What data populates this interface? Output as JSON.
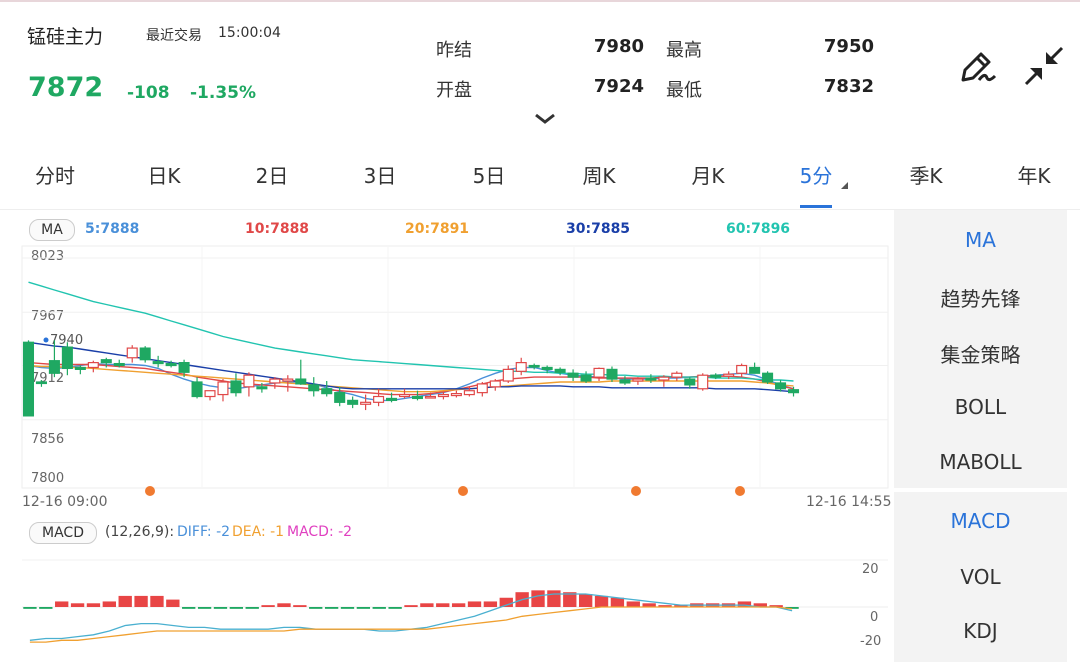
{
  "header": {
    "title": "锰硅主力",
    "last_trade_label": "最近交易",
    "last_trade_time": "15:00:04",
    "price": "7872",
    "change": "-108",
    "change_pct": "-1.35%",
    "price_color": "#1fa862",
    "stats": {
      "prev_settle_label": "昨结",
      "prev_settle": "7980",
      "high_label": "最高",
      "high": "7950",
      "open_label": "开盘",
      "open": "7924",
      "low_label": "最低",
      "low": "7832"
    },
    "icons": [
      "pen-icon",
      "collapse-icon",
      "chevron-down-icon"
    ]
  },
  "tabs": [
    {
      "label": "分时"
    },
    {
      "label": "日K"
    },
    {
      "label": "2日"
    },
    {
      "label": "3日"
    },
    {
      "label": "5日"
    },
    {
      "label": "周K"
    },
    {
      "label": "月K"
    },
    {
      "label": "5分",
      "active": true
    },
    {
      "label": "季K"
    },
    {
      "label": "年K"
    }
  ],
  "accent_color": "#2a73d9",
  "ma_indicator": {
    "badge": "MA",
    "values": [
      {
        "text": "5:7888",
        "color": "#4a90d9"
      },
      {
        "text": "10:7888",
        "color": "#e04848"
      },
      {
        "text": "20:7891",
        "color": "#f0a030"
      },
      {
        "text": "30:7885",
        "color": "#1a3fa8"
      },
      {
        "text": "60:7896",
        "color": "#22c4b0"
      }
    ]
  },
  "price_axis": {
    "labels": [
      "8023",
      "7967",
      "7912",
      "7856",
      "7800"
    ],
    "max_marker": "7940"
  },
  "time_axis": {
    "start": "12-16 09:00",
    "end": "12-16 14:55"
  },
  "macd_indicator": {
    "badge": "MACD",
    "params": "(12,26,9):",
    "diff": "DIFF: -2",
    "dea": "DEA: -1",
    "macd": "MACD: -2",
    "axis_labels": [
      "20",
      "0",
      "-20"
    ]
  },
  "sidebar": {
    "main_items": [
      "MA",
      "趋势先锋",
      "集金策略",
      "BOLL",
      "MABOLL"
    ],
    "sub_items": [
      "MACD",
      "VOL",
      "KDJ"
    ]
  },
  "chart_data": [
    {
      "type": "candlestick",
      "title": "",
      "ylim": [
        7800,
        8023
      ],
      "y_ticks": [
        8023,
        7967,
        7912,
        7856,
        7800
      ],
      "x_range": [
        "12-16 09:00",
        "12-16 14:55"
      ],
      "up_color": "#e04848",
      "down_color": "#1fa862",
      "candles": [
        [
          7936,
          7938,
          7894,
          7860
        ],
        [
          7895,
          7897,
          7890,
          7894
        ],
        [
          7917,
          7938,
          7900,
          7904
        ],
        [
          7931,
          7936,
          7902,
          7909
        ],
        [
          7910,
          7912,
          7903,
          7908
        ],
        [
          7910,
          7917,
          7905,
          7915
        ],
        [
          7918,
          7920,
          7910,
          7915
        ],
        [
          7914,
          7918,
          7910,
          7912
        ],
        [
          7920,
          7933,
          7915,
          7930
        ],
        [
          7930,
          7932,
          7915,
          7918
        ],
        [
          7916,
          7922,
          7910,
          7914
        ],
        [
          7914,
          7917,
          7910,
          7912
        ],
        [
          7915,
          7918,
          7900,
          7905
        ],
        [
          7895,
          7900,
          7878,
          7880
        ],
        [
          7880,
          7885,
          7876,
          7886
        ],
        [
          7882,
          7898,
          7875,
          7895
        ],
        [
          7896,
          7904,
          7880,
          7884
        ],
        [
          7890,
          7905,
          7880,
          7902
        ],
        [
          7890,
          7894,
          7884,
          7888
        ],
        [
          7894,
          7900,
          7888,
          7898
        ],
        [
          7896,
          7902,
          7885,
          7898
        ],
        [
          7898,
          7918,
          7892,
          7893
        ],
        [
          7892,
          7900,
          7880,
          7886
        ],
        [
          7888,
          7896,
          7880,
          7883
        ],
        [
          7884,
          7890,
          7870,
          7874
        ],
        [
          7876,
          7880,
          7868,
          7872
        ],
        [
          7872,
          7882,
          7866,
          7874
        ],
        [
          7874,
          7888,
          7870,
          7880
        ],
        [
          7878,
          7884,
          7874,
          7876
        ],
        [
          7880,
          7888,
          7878,
          7882
        ],
        [
          7880,
          7886,
          7876,
          7878
        ],
        [
          7879,
          7884,
          7878,
          7880
        ],
        [
          7880,
          7885,
          7877,
          7882
        ],
        [
          7881,
          7886,
          7879,
          7883
        ],
        [
          7882,
          7890,
          7880,
          7886
        ],
        [
          7884,
          7895,
          7880,
          7893
        ],
        [
          7890,
          7898,
          7886,
          7896
        ],
        [
          7896,
          7912,
          7894,
          7908
        ],
        [
          7906,
          7920,
          7902,
          7915
        ],
        [
          7912,
          7914,
          7908,
          7911
        ],
        [
          7910,
          7912,
          7904,
          7908
        ],
        [
          7908,
          7910,
          7902,
          7905
        ],
        [
          7904,
          7908,
          7896,
          7900
        ],
        [
          7902,
          7906,
          7894,
          7896
        ],
        [
          7900,
          7910,
          7896,
          7909
        ],
        [
          7908,
          7911,
          7895,
          7898
        ],
        [
          7897,
          7901,
          7892,
          7894
        ],
        [
          7896,
          7900,
          7892,
          7898
        ],
        [
          7899,
          7903,
          7894,
          7897
        ],
        [
          7897,
          7902,
          7890,
          7900
        ],
        [
          7900,
          7906,
          7896,
          7904
        ],
        [
          7898,
          7900,
          7888,
          7892
        ],
        [
          7888,
          7904,
          7886,
          7902
        ],
        [
          7902,
          7904,
          7898,
          7900
        ],
        [
          7901,
          7906,
          7898,
          7903
        ],
        [
          7904,
          7914,
          7900,
          7912
        ],
        [
          7910,
          7915,
          7904,
          7904
        ],
        [
          7904,
          7906,
          7893,
          7895
        ],
        [
          7894,
          7897,
          7885,
          7888
        ],
        [
          7887,
          7890,
          7880,
          7884
        ]
      ],
      "ma": {
        "MA5": {
          "color": "#4a90d9",
          "values": [
            7912,
            7910,
            7909,
            7910,
            7912,
            7914,
            7913,
            7913,
            7913,
            7912,
            7909,
            7903,
            7898,
            7894,
            7891,
            7889,
            7888,
            7890,
            7892,
            7894,
            7895,
            7895,
            7893,
            7889,
            7885,
            7882,
            7878,
            7876,
            7876,
            7878,
            7880,
            7882,
            7884,
            7888,
            7893,
            7899,
            7904,
            7908,
            7910,
            7910,
            7907,
            7904,
            7902,
            7901,
            7900,
            7899,
            7898,
            7898,
            7898,
            7899,
            7899,
            7900,
            7901,
            7902,
            7903,
            7904,
            7902,
            7897,
            7892,
            7888
          ]
        },
        "MA10": {
          "color": "#e04848",
          "values": [
            7915,
            7914,
            7913,
            7913,
            7913,
            7913,
            7912,
            7911,
            7910,
            7909,
            7907,
            7905,
            7903,
            7900,
            7898,
            7896,
            7894,
            7893,
            7892,
            7891,
            7890,
            7889,
            7888,
            7887,
            7886,
            7885,
            7884,
            7883,
            7882,
            7882,
            7882,
            7883,
            7885,
            7887,
            7890,
            7893,
            7896,
            7898,
            7899,
            7900,
            7900,
            7900,
            7900,
            7900,
            7899,
            7899,
            7899,
            7899,
            7899,
            7900,
            7900,
            7900,
            7901,
            7901,
            7901,
            7900,
            7898,
            7895,
            7891,
            7888
          ]
        },
        "MA20": {
          "color": "#f0a030",
          "values": [
            7912,
            7911,
            7911,
            7910,
            7910,
            7909,
            7908,
            7907,
            7906,
            7905,
            7904,
            7903,
            7902,
            7901,
            7900,
            7899,
            7898,
            7897,
            7896,
            7895,
            7894,
            7893,
            7892,
            7891,
            7890,
            7889,
            7888,
            7887,
            7886,
            7885,
            7885,
            7885,
            7886,
            7887,
            7888,
            7889,
            7890,
            7891,
            7892,
            7893,
            7894,
            7895,
            7895,
            7895,
            7895,
            7896,
            7896,
            7896,
            7896,
            7896,
            7896,
            7896,
            7896,
            7896,
            7896,
            7896,
            7895,
            7894,
            7892,
            7891
          ]
        },
        "MA30": {
          "color": "#1a3fa8",
          "values": [
            7936,
            7934,
            7932,
            7931,
            7929,
            7927,
            7925,
            7923,
            7921,
            7919,
            7917,
            7915,
            7913,
            7911,
            7909,
            7907,
            7905,
            7903,
            7901,
            7899,
            7897,
            7895,
            7893,
            7891,
            7889,
            7888,
            7888,
            7888,
            7888,
            7888,
            7888,
            7888,
            7888,
            7888,
            7888,
            7889,
            7890,
            7890,
            7891,
            7891,
            7891,
            7891,
            7890,
            7890,
            7890,
            7889,
            7889,
            7889,
            7889,
            7889,
            7889,
            7889,
            7889,
            7888,
            7888,
            7888,
            7888,
            7887,
            7886,
            7885
          ]
        },
        "MA60": {
          "color": "#22c4b0",
          "values": [
            7998,
            7994,
            7990,
            7986,
            7982,
            7978,
            7975,
            7972,
            7969,
            7966,
            7962,
            7958,
            7954,
            7950,
            7946,
            7942,
            7939,
            7936,
            7933,
            7930,
            7928,
            7926,
            7924,
            7922,
            7920,
            7918,
            7917,
            7916,
            7915,
            7914,
            7913,
            7912,
            7911,
            7910,
            7909,
            7908,
            7907,
            7906,
            7906,
            7905,
            7905,
            7904,
            7904,
            7903,
            7903,
            7902,
            7902,
            7901,
            7901,
            7901,
            7900,
            7900,
            7900,
            7899,
            7899,
            7899,
            7898,
            7897,
            7897,
            7896
          ]
        }
      }
    },
    {
      "type": "bar",
      "title": "",
      "series_name": "MACD",
      "ylim": [
        -20,
        20
      ],
      "hist": [
        -1,
        -1,
        3,
        2,
        2,
        3,
        6,
        6,
        6,
        4,
        -1,
        -1,
        -1,
        -1,
        -1,
        1,
        2,
        1,
        -1,
        -1,
        -1,
        -1,
        -1,
        -1,
        1,
        2,
        2,
        2,
        3,
        3,
        5,
        8,
        9,
        9,
        8,
        7,
        6,
        5,
        3,
        2,
        1,
        1,
        2,
        2,
        2,
        3,
        2,
        1,
        -1
      ],
      "diff": [
        -18,
        -17,
        -17,
        -16,
        -15,
        -13,
        -10,
        -9,
        -9,
        -10,
        -11,
        -11,
        -12,
        -12,
        -12,
        -12,
        -11,
        -11,
        -12,
        -12,
        -12,
        -12,
        -13,
        -13,
        -12,
        -11,
        -9,
        -7,
        -5,
        -2,
        1,
        4,
        6,
        7,
        7,
        7,
        6,
        5,
        4,
        3,
        2,
        1,
        1,
        1,
        1,
        1,
        0,
        0,
        -2
      ],
      "dea": [
        -19,
        -19,
        -18,
        -18,
        -17,
        -16,
        -15,
        -14,
        -13,
        -13,
        -13,
        -13,
        -13,
        -13,
        -13,
        -13,
        -13,
        -12,
        -12,
        -12,
        -12,
        -12,
        -12,
        -12,
        -12,
        -12,
        -11,
        -10,
        -9,
        -8,
        -7,
        -5,
        -4,
        -3,
        -2,
        -1,
        0,
        0,
        0,
        0,
        0,
        0,
        0,
        0,
        0,
        0,
        0,
        0,
        -1
      ]
    }
  ]
}
